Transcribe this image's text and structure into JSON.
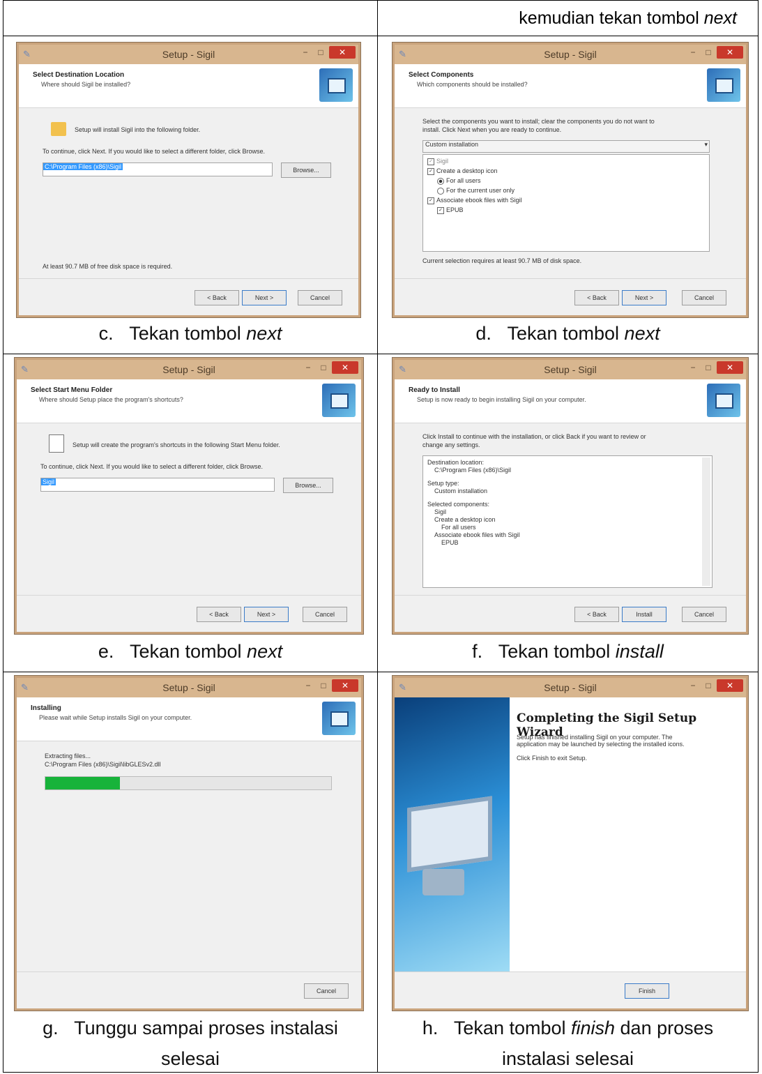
{
  "top_instruction": {
    "prefix": "kemudian tekan tombol ",
    "italic": "next"
  },
  "window_title": "Setup - Sigil",
  "buttons": {
    "back": "< Back",
    "next": "Next >",
    "cancel": "Cancel",
    "browse": "Browse...",
    "install": "Install",
    "finish": "Finish"
  },
  "steps": {
    "c": {
      "caption_label": "c.",
      "caption_prefix": "Tekan tombol ",
      "caption_italic": "next",
      "caption_suffix": "",
      "heading": "Select Destination Location",
      "subheading": "Where should Sigil be installed?",
      "lines": [
        "Setup will install Sigil into the following folder.",
        "To continue, click Next. If you would like to select a different folder, click Browse.",
        "At least 90.7 MB of free disk space is required."
      ],
      "path_value": "C:\\Program Files (x86)\\Sigil"
    },
    "d": {
      "caption_label": "d.",
      "caption_prefix": "Tekan tombol ",
      "caption_italic": "next",
      "caption_suffix": "",
      "heading": "Select Components",
      "subheading": "Which components should be installed?",
      "lines": [
        "Select the components you want to install; clear the components you do not want to",
        "install. Click Next when you are ready to continue.",
        "Current selection requires at least 90.7 MB of disk space."
      ],
      "combo_value": "Custom installation",
      "components": [
        "Sigil",
        "Create a desktop icon",
        "For all users",
        "For the current user only",
        "Associate ebook files with Sigil",
        "EPUB"
      ]
    },
    "e": {
      "caption_label": "e.",
      "caption_prefix": "Tekan tombol ",
      "caption_italic": "next",
      "caption_suffix": "",
      "heading": "Select Start Menu Folder",
      "subheading": "Where should Setup place the program's shortcuts?",
      "lines": [
        "Setup will create the program's shortcuts in the following Start Menu folder.",
        "To continue, click Next. If you would like to select a different folder, click Browse."
      ],
      "path_value": "Sigil"
    },
    "f": {
      "caption_label": "f.",
      "caption_prefix": "Tekan tombol ",
      "caption_italic": "install",
      "caption_suffix": "",
      "heading": "Ready to Install",
      "subheading": "Setup is now ready to begin installing Sigil on your computer.",
      "lines": [
        "Click Install to continue with the installation, or click Back if you want to review or",
        "change any settings."
      ],
      "summary": [
        "Destination location:",
        "C:\\Program Files (x86)\\Sigil",
        "Setup type:",
        "Custom installation",
        "Selected components:",
        "Sigil",
        "Create a desktop icon",
        "For all users",
        "Associate ebook files with Sigil",
        "EPUB"
      ]
    },
    "g": {
      "caption_label": "g.",
      "caption_line1": "Tunggu sampai proses instalasi",
      "caption_line2": "selesai",
      "heading": "Installing",
      "subheading": "Please wait while Setup installs Sigil on your computer.",
      "lines": [
        "Extracting files...",
        "C:\\Program Files (x86)\\Sigil\\libGLESv2.dll"
      ],
      "progress": 0.26
    },
    "h": {
      "caption_label": "h.",
      "caption_prefix": "Tekan tombol ",
      "caption_italic": "finish",
      "caption_suffix": " dan proses",
      "caption_line2": "instalasi selesai",
      "heading": "Completing the Sigil Setup Wizard",
      "lines": [
        "Setup has finished installing Sigil on your computer. The",
        "application may be launched by selecting the installed icons.",
        "Click Finish to exit Setup."
      ]
    }
  }
}
